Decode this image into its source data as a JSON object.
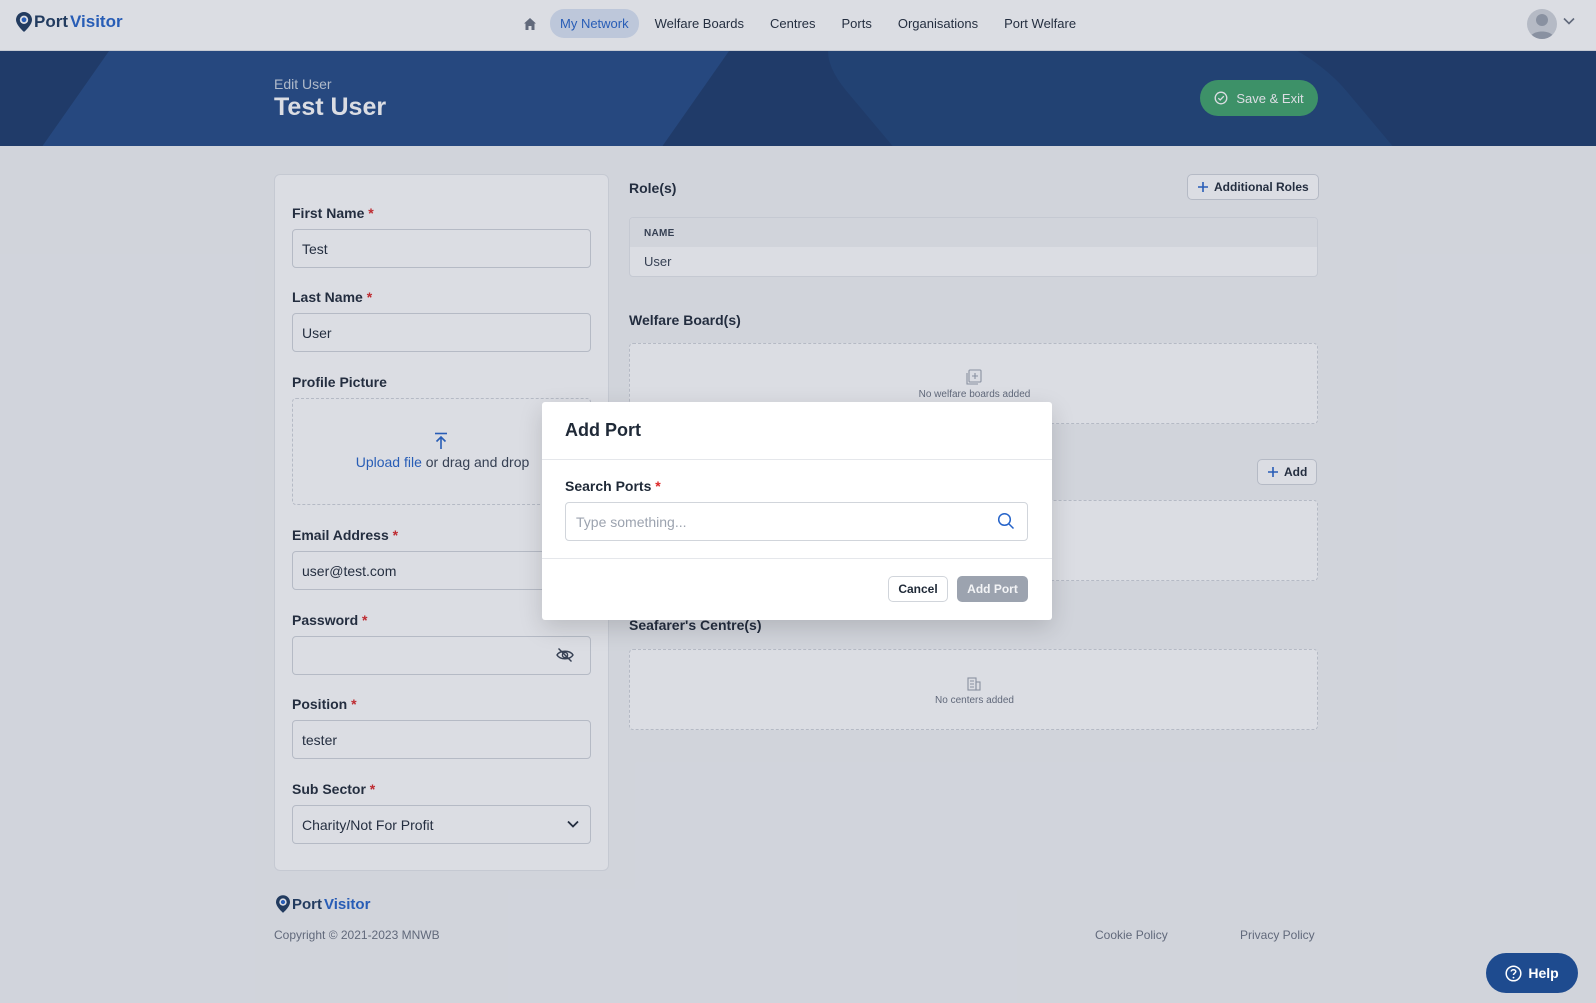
{
  "nav": {
    "logo_part1": "Port",
    "logo_part2": "Visitor",
    "links": [
      "My Network",
      "Welfare Boards",
      "Centres",
      "Ports",
      "Organisations",
      "Port Welfare"
    ],
    "active": "My Network"
  },
  "banner": {
    "subtitle": "Edit User",
    "title": "Test User",
    "save_label": "Save & Exit"
  },
  "form": {
    "first_name_label": "First Name",
    "first_name_value": "Test",
    "last_name_label": "Last Name",
    "last_name_value": "User",
    "profile_picture_label": "Profile Picture",
    "upload_link": "Upload file",
    "upload_rest": " or drag and drop",
    "email_label": "Email Address",
    "email_value": "user@test.com",
    "password_label": "Password",
    "password_value": "",
    "position_label": "Position",
    "position_value": "tester",
    "sub_sector_label": "Sub Sector",
    "sub_sector_value": "Charity/Not For Profit",
    "required_mark": "*"
  },
  "roles": {
    "title": "Role(s)",
    "additional_roles_label": "Additional Roles",
    "column_header": "NAME",
    "rows": [
      "User"
    ]
  },
  "welfare_boards": {
    "title": "Welfare Board(s)",
    "empty_text": "No welfare boards added"
  },
  "ports_section": {
    "add_label": "Add"
  },
  "centres": {
    "title": "Seafarer's Centre(s)",
    "empty_text": "No centers added"
  },
  "footer": {
    "copyright": "Copyright © 2021-2023 MNWB",
    "cookie_policy": "Cookie Policy",
    "privacy_policy": "Privacy Policy"
  },
  "help_label": "Help",
  "modal": {
    "title": "Add Port",
    "search_label": "Search Ports",
    "search_placeholder": "Type something...",
    "cancel_label": "Cancel",
    "add_label": "Add Port"
  },
  "colors": {
    "brand_dark": "#1c3a6b",
    "brand_blue": "#2563c9",
    "save_green": "#3fa36a",
    "required_red": "#dc2626"
  }
}
